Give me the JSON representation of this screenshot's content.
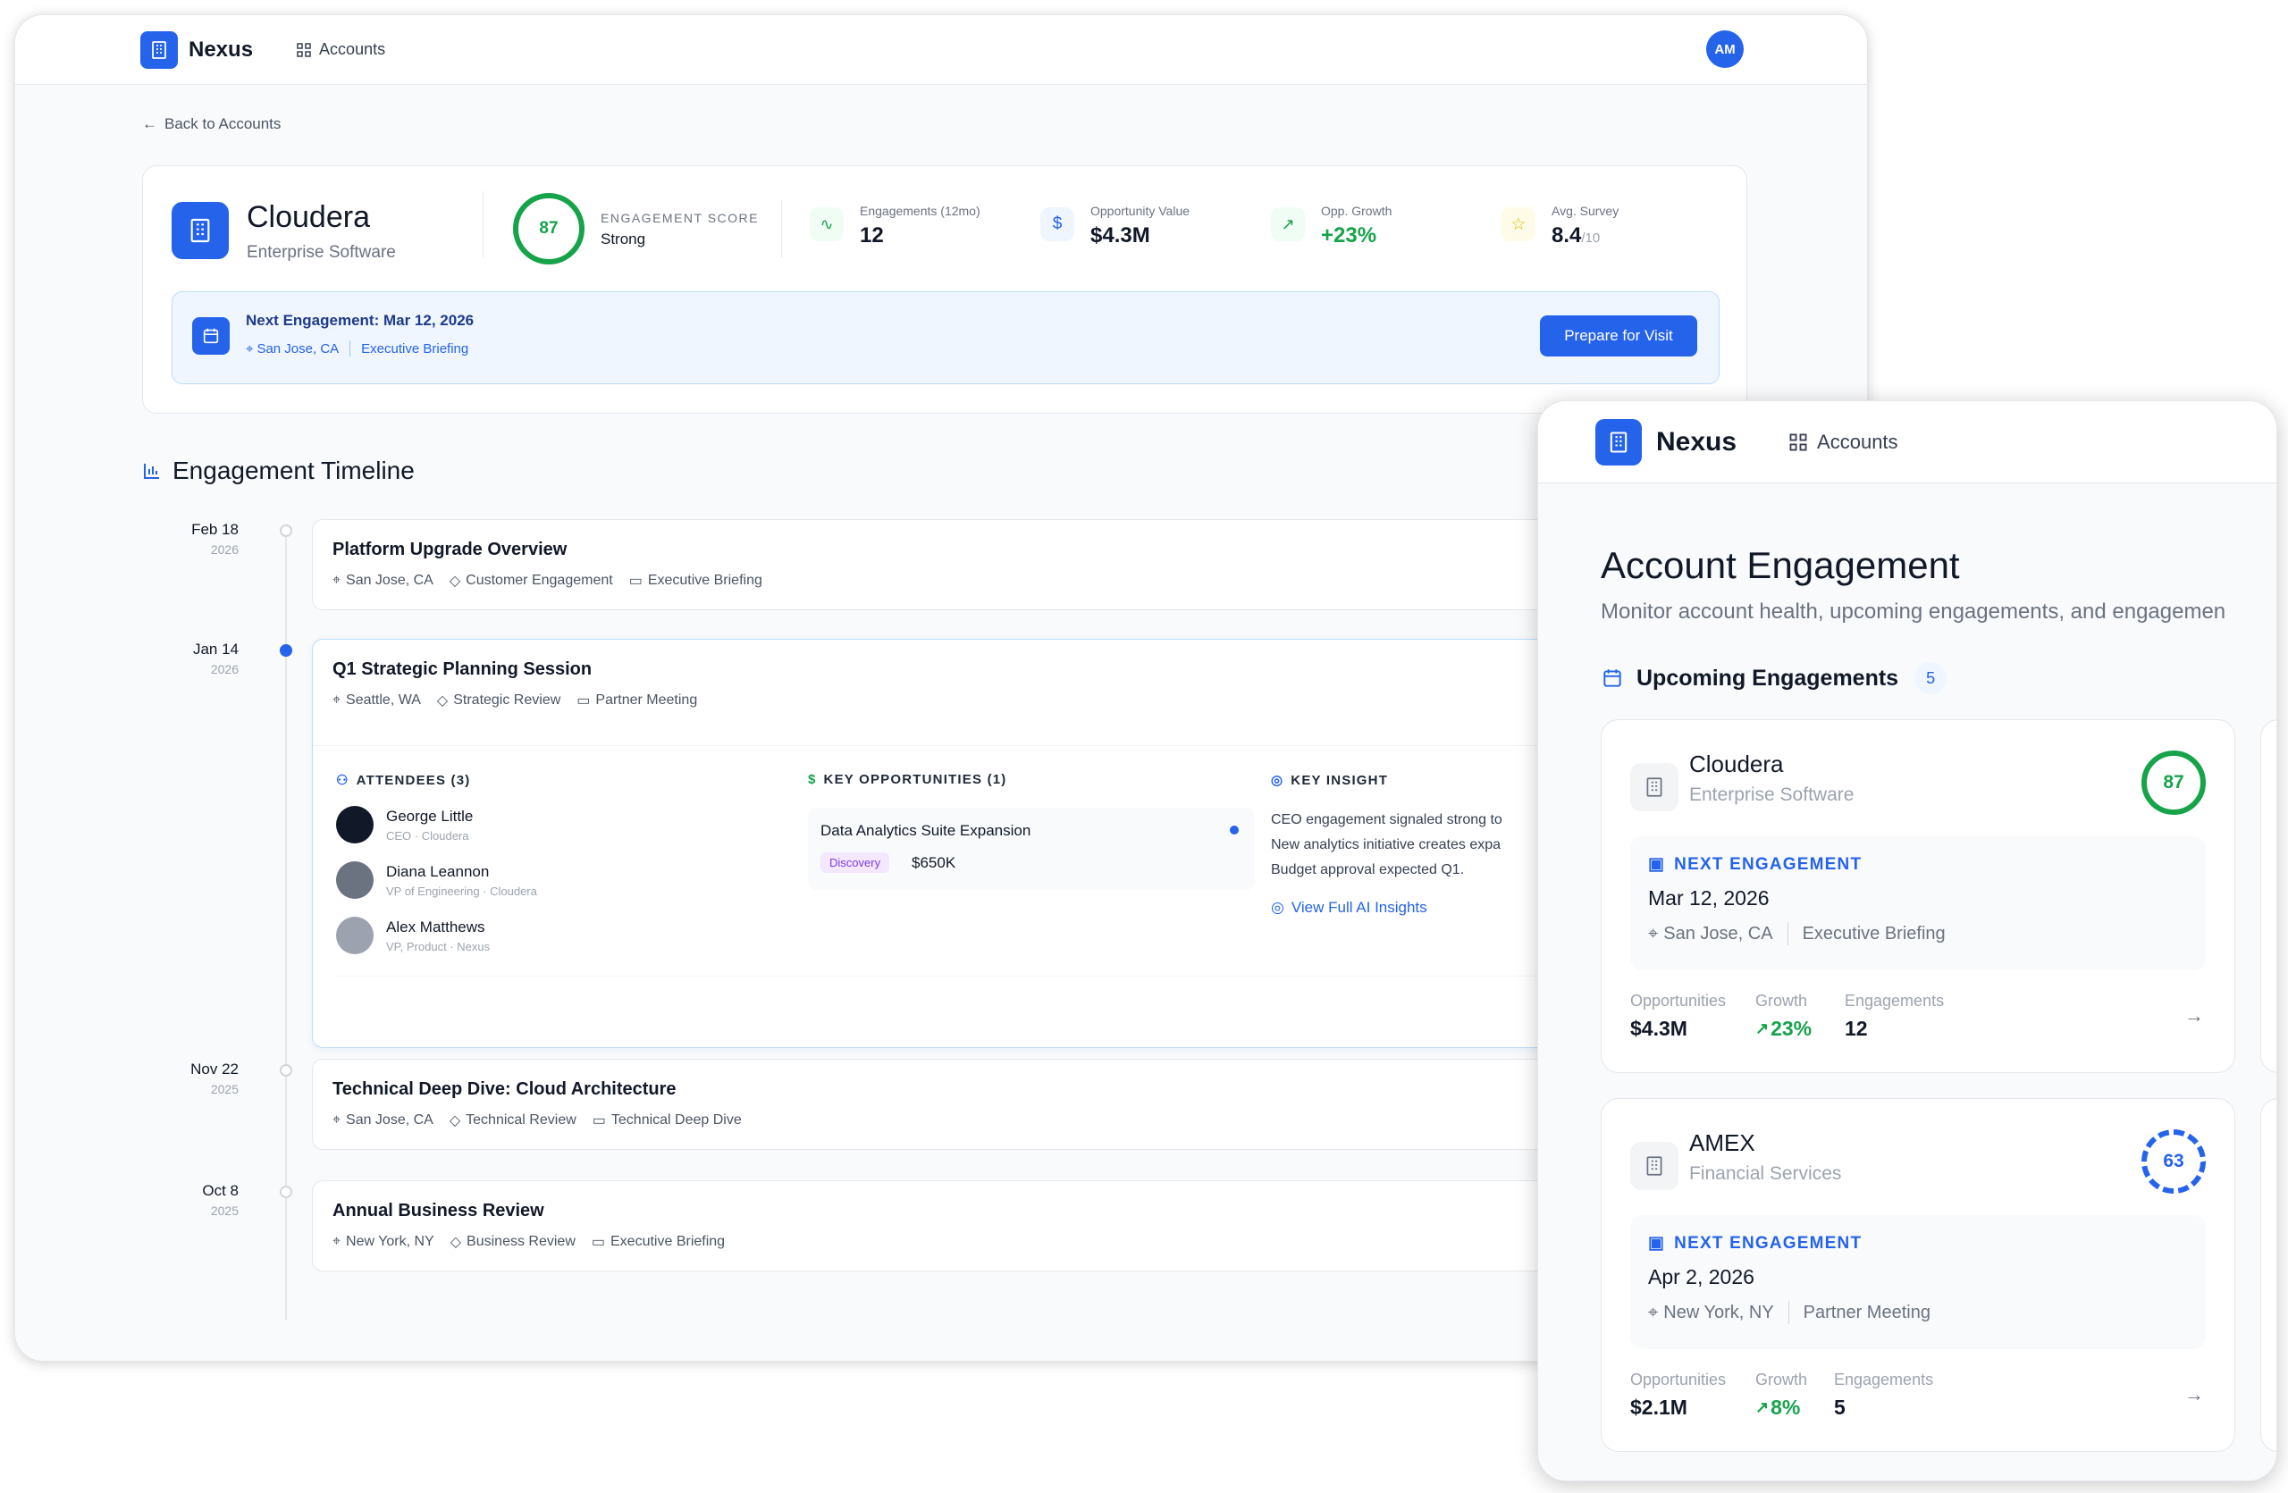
{
  "brand": {
    "name": "Nexus",
    "nav_accounts": "Accounts",
    "user_initials": "AM"
  },
  "colors": {
    "accent": "#2563eb",
    "positive": "#16a34a",
    "highlight_bg": "#eff6ff"
  },
  "detail": {
    "back_label": "Back to Accounts",
    "account": {
      "name": "Cloudera",
      "industry": "Enterprise Software"
    },
    "score": {
      "value": "87",
      "label": "ENGAGEMENT SCORE",
      "status": "Strong"
    },
    "metrics": [
      {
        "label": "Engagements (12mo)",
        "value": "12",
        "icon": "activity-icon"
      },
      {
        "label": "Opportunity Value",
        "value": "$4.3M",
        "icon": "dollar-icon"
      },
      {
        "label": "Opp. Growth",
        "value": "+23%",
        "icon": "trending-up-icon"
      },
      {
        "label": "Avg. Survey",
        "value": "8.4",
        "suffix": "/10",
        "icon": "star-icon"
      }
    ],
    "next": {
      "title": "Next Engagement: Mar 12, 2026",
      "location": "San Jose, CA",
      "type": "Executive Briefing",
      "button": "Prepare for Visit"
    },
    "timeline_title": "Engagement Timeline",
    "timeline": [
      {
        "date": "Feb 18",
        "year": "2026",
        "title": "Platform Upgrade Overview",
        "location": "San Jose, CA",
        "tag": "Customer Engagement",
        "type": "Executive Briefing"
      },
      {
        "date": "Jan 14",
        "year": "2026",
        "title": "Q1 Strategic Planning Session",
        "location": "Seattle, WA",
        "tag": "Strategic Review",
        "type": "Partner Meeting"
      },
      {
        "date": "Nov 22",
        "year": "2025",
        "title": "Technical Deep Dive: Cloud Architecture",
        "location": "San Jose, CA",
        "tag": "Technical Review",
        "type": "Technical Deep Dive"
      },
      {
        "date": "Oct 8",
        "year": "2025",
        "title": "Annual Business Review",
        "location": "New York, NY",
        "tag": "Business Review",
        "type": "Executive Briefing"
      }
    ],
    "expanded": {
      "attendees_title": "ATTENDEES (3)",
      "attendees": [
        {
          "name": "George Little",
          "role": "CEO · Cloudera"
        },
        {
          "name": "Diana Leannon",
          "role": "VP of Engineering · Cloudera"
        },
        {
          "name": "Alex Matthews",
          "role": "VP, Product · Nexus"
        }
      ],
      "opps_title": "KEY OPPORTUNITIES (1)",
      "opportunity": {
        "name": "Data Analytics Suite Expansion",
        "stage": "Discovery",
        "value": "$650K"
      },
      "insight_title": "KEY INSIGHT",
      "insight_lines": [
        "CEO engagement signaled strong to",
        "New analytics initiative creates expa",
        "Budget approval expected Q1."
      ],
      "insight_link": "View Full AI Insights"
    }
  },
  "overview": {
    "title": "Account Engagement",
    "subtitle": "Monitor account health, upcoming engagements, and engagemen",
    "upcoming_title": "Upcoming Engagements",
    "upcoming_count": "5",
    "next_label": "NEXT ENGAGEMENT",
    "stat_labels": {
      "opps": "Opportunities",
      "growth": "Growth",
      "eng": "Engagements"
    },
    "cards": [
      {
        "name": "Cloudera",
        "industry": "Enterprise Software",
        "score": "87",
        "date": "Mar 12, 2026",
        "location": "San Jose, CA",
        "type": "Executive Briefing",
        "opps": "$4.3M",
        "growth": "23%",
        "eng": "12"
      },
      {
        "name": "AMEX",
        "industry": "Financial Services",
        "score": "63",
        "date": "Apr 2, 2026",
        "location": "New York, NY",
        "type": "Partner Meeting",
        "opps": "$2.1M",
        "growth": "8%",
        "eng": "5"
      }
    ]
  }
}
